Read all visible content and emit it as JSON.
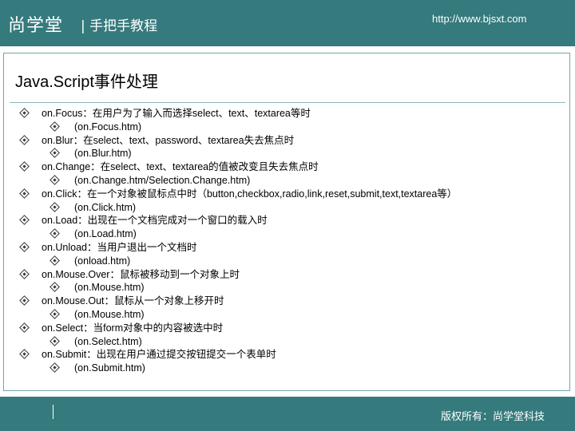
{
  "header": {
    "brand": "尚学堂",
    "subtitle": "| 手把手教程",
    "url": "http://www.bjsxt.com"
  },
  "title": "Java.Script事件处理",
  "items": [
    {
      "text": "on.Focus：在用户为了输入而选择select、text、textarea等时",
      "level": 1
    },
    {
      "text": "(on.Focus.htm)",
      "level": 2
    },
    {
      "text": "on.Blur：在select、text、password、textarea失去焦点时",
      "level": 1
    },
    {
      "text": "(on.Blur.htm)",
      "level": 2
    },
    {
      "text": "on.Change：在select、text、textarea的值被改变且失去焦点时",
      "level": 1
    },
    {
      "text": "(on.Change.htm/Selection.Change.htm)",
      "level": 2
    },
    {
      "text": "on.Click：在一个对象被鼠标点中时（button,checkbox,radio,link,reset,submit,text,textarea等）",
      "level": 1
    },
    {
      "text": "(on.Click.htm)",
      "level": 2
    },
    {
      "text": "on.Load：出现在一个文档完成对一个窗口的载入时",
      "level": 1
    },
    {
      "text": "(on.Load.htm)",
      "level": 2
    },
    {
      "text": "on.Unload：当用户退出一个文档时",
      "level": 1
    },
    {
      "text": "(onload.htm)",
      "level": 2
    },
    {
      "text": "on.Mouse.Over：鼠标被移动到一个对象上时",
      "level": 1
    },
    {
      "text": "(on.Mouse.htm)",
      "level": 2
    },
    {
      "text": "on.Mouse.Out：鼠标从一个对象上移开时",
      "level": 1
    },
    {
      "text": "(on.Mouse.htm)",
      "level": 2
    },
    {
      "text": "on.Select：当form对象中的内容被选中时",
      "level": 1
    },
    {
      "text": "(on.Select.htm)",
      "level": 2
    },
    {
      "text": "on.Submit：出现在用户通过提交按钮提交一个表单时",
      "level": 1
    },
    {
      "text": "(on.Submit.htm)",
      "level": 2
    }
  ],
  "footer": {
    "copyright": "版权所有：尚学堂科技"
  }
}
